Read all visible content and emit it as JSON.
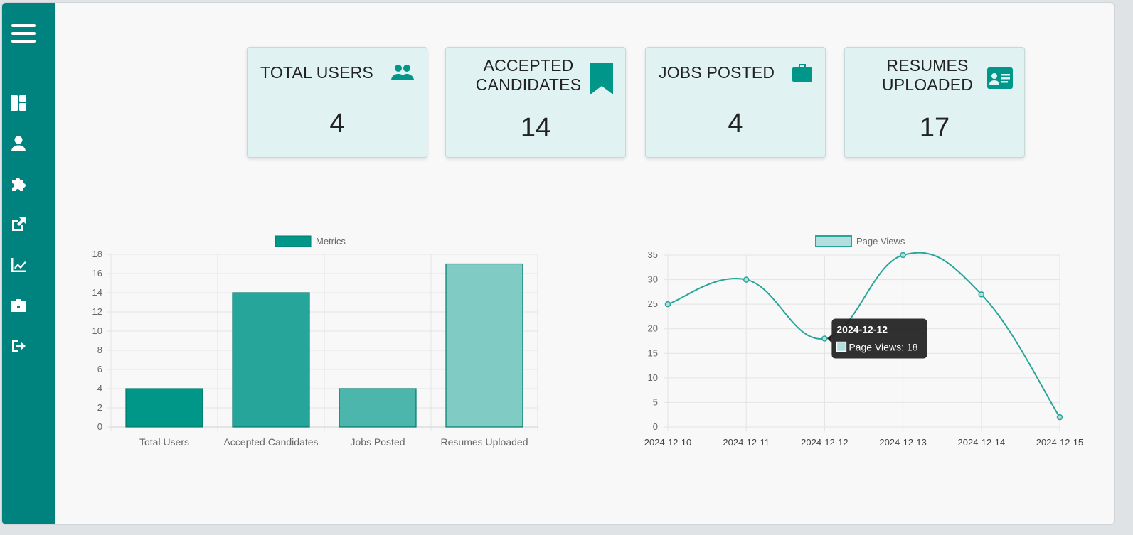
{
  "sidebar": {
    "items": [
      {
        "name": "dashboard-icon"
      },
      {
        "name": "user-icon"
      },
      {
        "name": "puzzle-icon"
      },
      {
        "name": "external-link-icon"
      },
      {
        "name": "chart-line-icon"
      },
      {
        "name": "briefcase-icon"
      },
      {
        "name": "logout-icon"
      }
    ]
  },
  "cards": [
    {
      "title": "TOTAL USERS",
      "value": "4",
      "icon": "users-icon"
    },
    {
      "title_line1": "ACCEPTED",
      "title_line2": "CANDIDATES",
      "value": "14",
      "icon": "bookmark-icon"
    },
    {
      "title": "JOBS POSTED",
      "value": "4",
      "icon": "briefcase-icon"
    },
    {
      "title_line1": "RESUMES",
      "title_line2": "UPLOADED",
      "value": "17",
      "icon": "id-card-icon"
    }
  ],
  "colors": {
    "sidebar": "#00827f",
    "accent": "#00968a",
    "card_bg": "#e0f2f1"
  },
  "chart_data": [
    {
      "type": "bar",
      "legend": "Metrics",
      "legend_position": "top",
      "categories": [
        "Total Users",
        "Accepted Candidates",
        "Jobs Posted",
        "Resumes Uploaded"
      ],
      "values": [
        4,
        14,
        4,
        17
      ],
      "colors": [
        "#009688",
        "#26a69a",
        "#4db6ac",
        "#80cbc4"
      ],
      "ylim": [
        0,
        18
      ],
      "yticks": [
        0,
        2,
        4,
        6,
        8,
        10,
        12,
        14,
        16,
        18
      ],
      "grid": true
    },
    {
      "type": "line",
      "legend": "Page Views",
      "legend_position": "top",
      "x": [
        "2024-12-10",
        "2024-12-11",
        "2024-12-12",
        "2024-12-13",
        "2024-12-14",
        "2024-12-15"
      ],
      "values": [
        25,
        30,
        18,
        35,
        27,
        2
      ],
      "ylim": [
        0,
        35
      ],
      "yticks": [
        0,
        5,
        10,
        15,
        20,
        25,
        30,
        35
      ],
      "grid": true,
      "tooltip": {
        "title": "2024-12-12",
        "label": "Page Views: 18"
      }
    }
  ]
}
